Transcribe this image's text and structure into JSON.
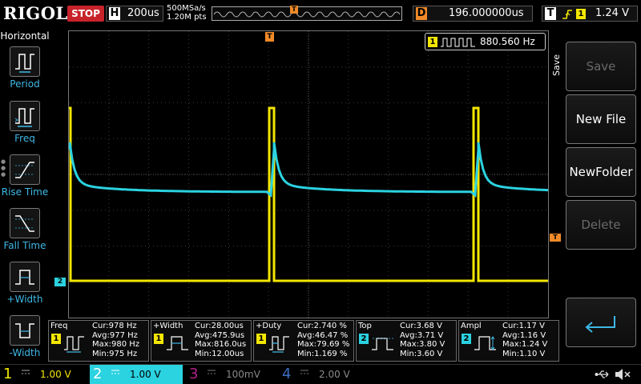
{
  "topbar": {
    "logo": "RIGOL",
    "run_state": "STOP",
    "timebase_label": "H",
    "timebase_value": "200us",
    "sample_rate": "500MSa/s",
    "memory_depth": "1.20M pts",
    "trigger_position_marker": "T",
    "delay_label": "D",
    "delay_value": "196.000000us",
    "trigger_label": "T",
    "trigger_source": "1",
    "trigger_level": "1.24 V"
  },
  "left_panel": {
    "title": "Horizontal",
    "items": [
      {
        "label": "Period",
        "icon": "period-icon"
      },
      {
        "label": "Freq",
        "icon": "freq-icon"
      },
      {
        "label": "Rise Time",
        "icon": "rise-time-icon"
      },
      {
        "label": "Fall Time",
        "icon": "fall-time-icon"
      },
      {
        "label": "+Width",
        "icon": "positive-width-icon"
      },
      {
        "label": "-Width",
        "icon": "negative-width-icon"
      }
    ]
  },
  "screen": {
    "trigger_marker": "T",
    "trigger_level_marker": "T",
    "ch2_marker": "2",
    "frequency_counter": {
      "source": "1",
      "value": "880.560 Hz"
    }
  },
  "measurements": [
    {
      "title": "Freq",
      "source": "1",
      "cur": "Cur:978 Hz",
      "avg": "Avg:977 Hz",
      "max": "Max:980 Hz",
      "min": "Min:975 Hz"
    },
    {
      "title": "+Width",
      "source": "1",
      "cur": "Cur:28.00us",
      "avg": "Avg:475.9us",
      "max": "Max:816.0us",
      "min": "Min:12.00us"
    },
    {
      "title": "+Duty",
      "source": "1",
      "cur": "Cur:2.740 %",
      "avg": "Avg:46.47 %",
      "max": "Max:79.69 %",
      "min": "Min:1.169 %"
    },
    {
      "title": "Top",
      "source": "2",
      "cur": "Cur:3.68 V",
      "avg": "Avg:3.71 V",
      "max": "Max:3.80 V",
      "min": "Min:3.60 V"
    },
    {
      "title": "Ampl",
      "source": "2",
      "cur": "Cur:1.17 V",
      "avg": "Avg:1.16 V",
      "max": "Max:1.24 V",
      "min": "Min:1.10 V"
    }
  ],
  "softkeys": {
    "menu_title": "Save",
    "keys": [
      {
        "label": "Save",
        "enabled": false
      },
      {
        "label": "New File",
        "enabled": true
      },
      {
        "label": "NewFolder",
        "enabled": true
      },
      {
        "label": "Delete",
        "enabled": false
      }
    ],
    "enter_icon": "enter-arrow-icon"
  },
  "channels": [
    {
      "number": "1",
      "scale": "1.00 V",
      "color": "#f3e600",
      "active": false
    },
    {
      "number": "2",
      "scale": "1.00 V",
      "color": "#2bd2e0",
      "active": true
    },
    {
      "number": "3",
      "scale": "100mV",
      "color": "#b0208a",
      "active": false
    },
    {
      "number": "4",
      "scale": "2.00 V",
      "color": "#3b6ec0",
      "active": false
    }
  ],
  "colors": {
    "ch1": "#f3e600",
    "ch2": "#2bd2e0",
    "trigger": "#f08a28",
    "stop": "#c8232a"
  }
}
